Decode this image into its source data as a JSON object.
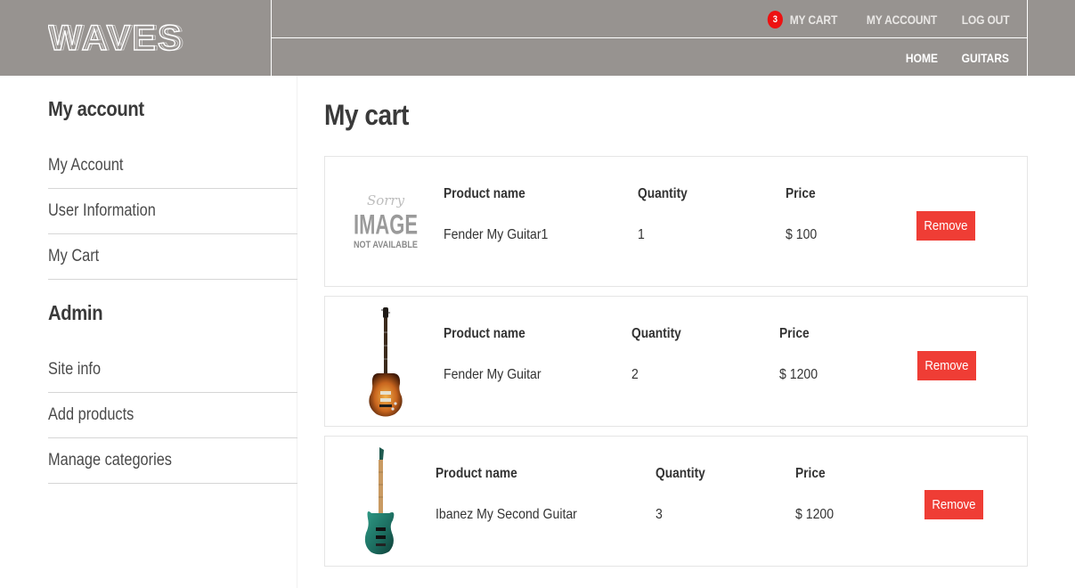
{
  "header": {
    "logo_text": "WAVES",
    "cart_count": "3",
    "top_links": [
      "My Cart",
      "My Account",
      "Log Out"
    ],
    "nav_links": [
      "Home",
      "Guitars"
    ]
  },
  "sidebar": {
    "account_heading": "My account",
    "account_items": [
      "My Account",
      "User Information",
      "My Cart"
    ],
    "admin_heading": "Admin",
    "admin_items": [
      "Site info",
      "Add products",
      "Manage categories"
    ]
  },
  "main": {
    "title": "My cart",
    "column_labels": {
      "name": "Product name",
      "quantity": "Quantity",
      "price": "Price"
    },
    "remove_label": "Remove",
    "placeholder_image_text": [
      "Sorry",
      "IMAGE",
      "NOT AVAILABLE"
    ],
    "items": [
      {
        "name": "Fender My Guitar1",
        "quantity": "1",
        "price": "$ 100",
        "image": "no-image"
      },
      {
        "name": "Fender My Guitar",
        "quantity": "2",
        "price": "$ 1200",
        "image": "sunburst-guitar"
      },
      {
        "name": "Ibanez My Second Guitar",
        "quantity": "3",
        "price": "$ 1200",
        "image": "green-guitar"
      }
    ]
  }
}
